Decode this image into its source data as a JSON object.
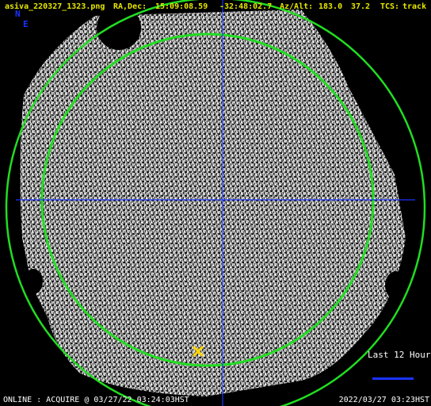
{
  "header": {
    "filename": "asiva_220327_1323.png",
    "radec_label": "RA,Dec:",
    "ra": "15:09:08.59",
    "dec": "-32:48:02.7",
    "azalt_label": "Az/Alt:",
    "az": "183.0",
    "alt": "37.2",
    "tcs_label": "TCS:",
    "tcs_status": "track"
  },
  "compass": {
    "north": "N",
    "east": "E"
  },
  "footer": {
    "status": "ONLINE : ACQUIRE @ 03/27/22 03:24:03HST",
    "timestamp": "2022/03/27 03:23HST"
  },
  "legend": {
    "last_hours_label": "Last 12 Hours"
  },
  "colors": {
    "header_text": "#e8e800",
    "circle": "#22dd22",
    "crosshair": "#1a34ff",
    "marker": "#ffd700",
    "footer_text": "#ffffff"
  }
}
